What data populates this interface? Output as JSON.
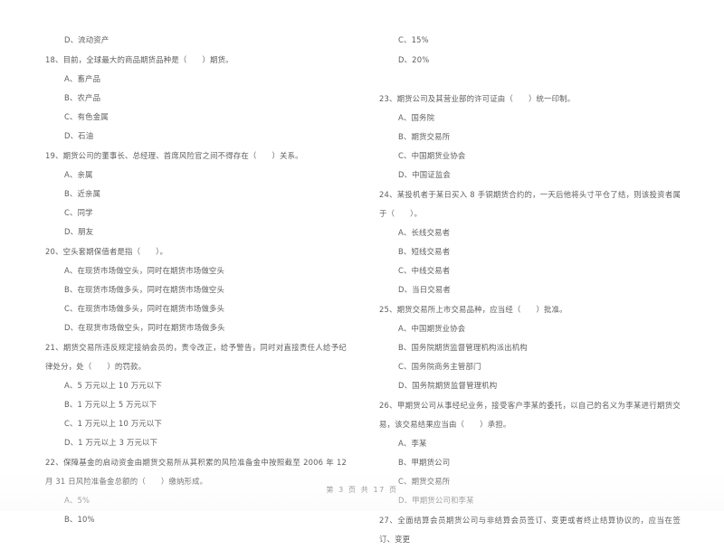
{
  "document": {
    "page_footer": "第 3 页 共 17 页",
    "page_number": "3",
    "total_pages": "17"
  },
  "left_column": {
    "blocks": [
      {
        "type": "option",
        "text": "D、流动资产"
      },
      {
        "type": "question",
        "number": "18",
        "stem": "18、目前，全球最大的商品期货品种是（      ）期货。",
        "options": [
          "A、畜产品",
          "B、农产品",
          "C、有色金属",
          "D、石油"
        ]
      },
      {
        "type": "question",
        "number": "19",
        "stem": "19、期货公司的董事长、总经理、首席风险官之间不得存在（      ）关系。",
        "options": [
          "A、亲属",
          "B、近亲属",
          "C、同学",
          "D、朋友"
        ]
      },
      {
        "type": "question",
        "number": "20",
        "stem": "20、空头套期保值者是指（      ）。",
        "options": [
          "A、在现货市场做空头，同时在期货市场做空头",
          "B、在现货市场做多头，同时在期货市场做空头",
          "C、在现货市场做多头，同时在期货市场做多头",
          "D、在现货市场做空头，同时在期货市场做多头"
        ]
      },
      {
        "type": "question",
        "number": "21",
        "stem": "21、期货交易所违反规定接纳会员的，责令改正，给予警告，同时对直接责任人给予纪律处分，处（      ）的罚款。",
        "options": [
          "A、5 万元以上 10 万元以下",
          "B、1 万元以上 5 万元以下",
          "C、1 万元以上 10 万元以下",
          "D、1 万元以上 3 万元以下"
        ]
      },
      {
        "type": "question",
        "number": "22",
        "stem": "22、保障基金的启动资金由期货交易所从其积累的风险准备金中按照截至 2006 年 12 月 31 日风险准备金总额的（      ）缴纳形成。",
        "options": [
          "A、5%",
          "B、10%"
        ]
      }
    ]
  },
  "right_column": {
    "blocks": [
      {
        "type": "option",
        "text": "C、15%"
      },
      {
        "type": "option",
        "text": "D、20%"
      },
      {
        "type": "blank"
      },
      {
        "type": "question",
        "number": "23",
        "stem": "23、期货公司及其营业部的许可证由（      ）统一印制。",
        "options": [
          "A、国务院",
          "B、期货交易所",
          "C、中国期货业协会",
          "D、中国证监会"
        ]
      },
      {
        "type": "question",
        "number": "24",
        "stem": "24、某投机者于某日买入 8 手铜期货合约的，一天后他将头寸平仓了结，则该投资者属于（      ）。",
        "options": [
          "A、长线交易者",
          "B、短线交易者",
          "C、中线交易者",
          "D、当日交易者"
        ]
      },
      {
        "type": "question",
        "number": "25",
        "stem": "25、期货交易所上市交易品种，应当经（      ）批准。",
        "options": [
          "A、中国期货业协会",
          "B、国务院期货监督管理机构派出机构",
          "C、国务院商务主管部门",
          "D、国务院期货监督管理机构"
        ]
      },
      {
        "type": "question",
        "number": "26",
        "stem": "26、甲期货公司从事经纪业务，接受客户李某的委托，以自己的名义为李某进行期货交易，该交易结果应当由（      ）承担。",
        "options": [
          "A、李某",
          "B、甲期货公司",
          "C、期货交易所",
          "D、甲期货公司和李某"
        ]
      },
      {
        "type": "question",
        "number": "27",
        "stem": "27、全面结算会员期货公司与非结算会员签订、变更或者终止结算协议的，应当在签订、变更",
        "options": []
      }
    ]
  }
}
